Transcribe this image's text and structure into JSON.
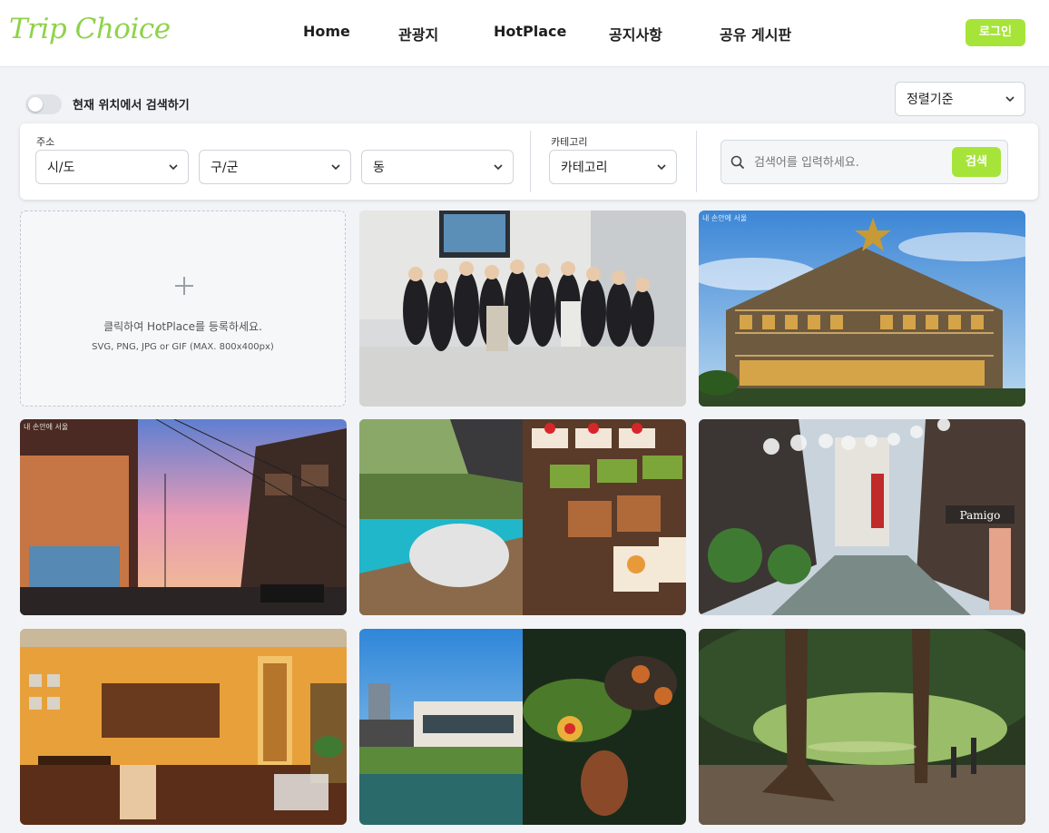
{
  "header": {
    "logo": "Trip Choice",
    "nav": [
      "Home",
      "관광지",
      "HotPlace",
      "공지사항",
      "공유 게시판"
    ],
    "login": "로그인"
  },
  "location_toggle": {
    "label": "현재 위치에서 검색하기",
    "on": false
  },
  "sort": {
    "selected": "정렬기준"
  },
  "filters": {
    "address_label": "주소",
    "sido": "시/도",
    "gugun": "구/군",
    "dong": "동",
    "category_label": "카테고리",
    "category": "카테고리"
  },
  "search": {
    "placeholder": "검색어를 입력하세요.",
    "button": "검색"
  },
  "upload": {
    "text": "클릭하여 HotPlace를 등록하세요.",
    "hint": "SVG, PNG, JPG or GIF (MAX. 800x400px)"
  },
  "places": [
    {
      "scene": "group-photo"
    },
    {
      "scene": "star-building",
      "badge": "내 손안에 서울"
    },
    {
      "scene": "sunset-street",
      "badge": "내 손안에 서울"
    },
    {
      "scene": "dessert-garden"
    },
    {
      "scene": "shopping-street",
      "sign": "Pamigo"
    },
    {
      "scene": "cozy-cafe"
    },
    {
      "scene": "pond-dessert"
    },
    {
      "scene": "forest-park"
    }
  ],
  "colors": {
    "accent": "#a6e43a",
    "logo": "#8fd24a"
  }
}
